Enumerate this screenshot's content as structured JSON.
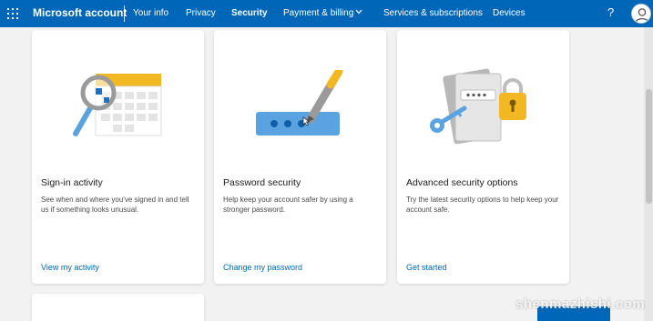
{
  "header": {
    "brand": "Microsoft account",
    "nav": [
      "Your info",
      "Privacy",
      "Security",
      "Payment & billing",
      "Services & subscriptions",
      "Devices"
    ],
    "active_tab": "Security",
    "help_label": "?"
  },
  "cards": [
    {
      "title": "Sign-in activity",
      "description": "See when and where you've signed in and tell us if something looks unusual.",
      "link": "View my activity"
    },
    {
      "title": "Password security",
      "description": "Help keep your account safer by using a stronger password.",
      "link": "Change my password"
    },
    {
      "title": "Advanced security options",
      "description": "Try the latest security options to help keep your account safe.",
      "link": "Get started"
    }
  ],
  "watermark": "shenmazhishi.com",
  "colors": {
    "brand_blue": "#0067b8",
    "illustration_blue": "#5aa3e0",
    "illustration_yellow": "#f2b824",
    "page_background": "#f2f2f2"
  }
}
